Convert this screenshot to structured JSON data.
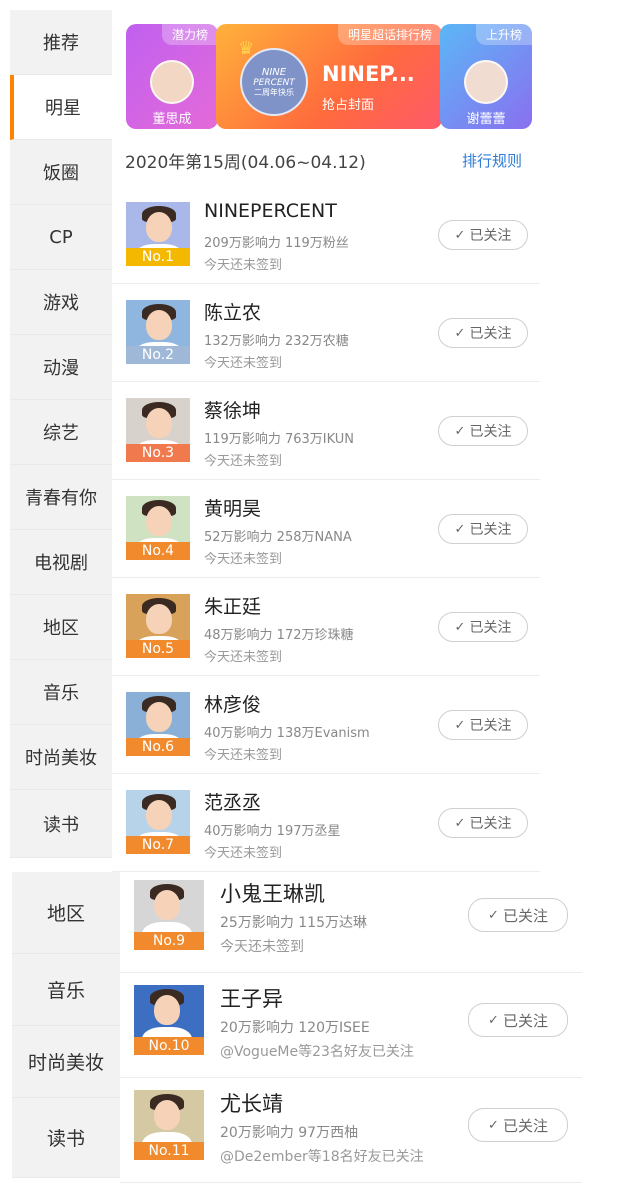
{
  "sidebar_top": {
    "items": [
      "推荐",
      "明星",
      "饭圈",
      "CP",
      "游戏",
      "动漫",
      "综艺",
      "青春有你",
      "电视剧",
      "地区",
      "音乐",
      "时尚美妆",
      "读书"
    ],
    "active_index": 1
  },
  "sidebar_bottom": {
    "items": [
      "地区",
      "音乐",
      "时尚美妆",
      "读书"
    ]
  },
  "banner": {
    "left": {
      "tag": "潜力榜",
      "name": "董思成"
    },
    "center": {
      "tag": "明星超话排行榜",
      "title": "NINEP...",
      "subtitle": "抢占封面",
      "logo_line1": "NINE",
      "logo_line2": "PERCENT",
      "logo_line3": "二周年快乐"
    },
    "right": {
      "tag": "上升榜",
      "name": "谢蕾蕾"
    }
  },
  "week": {
    "label": "2020年第15周(04.06~04.12)",
    "rules": "排行规则"
  },
  "follow_label": "已关注",
  "rows": [
    {
      "name": "NINEPERCENT",
      "stats": "209万影响力 119万粉丝",
      "sub": "今天还未签到",
      "rank": "No.1",
      "rank_color": "#f5b800",
      "bg": "#a9b8e8"
    },
    {
      "name": "陈立农",
      "stats": "132万影响力 232万农糖",
      "sub": "今天还未签到",
      "rank": "No.2",
      "rank_color": "#9fb8d8",
      "bg": "#8fb6de"
    },
    {
      "name": "蔡徐坤",
      "stats": "119万影响力 763万IKUN",
      "sub": "今天还未签到",
      "rank": "No.3",
      "rank_color": "#f07a4e",
      "bg": "#d8d2cc"
    },
    {
      "name": "黄明昊",
      "stats": "52万影响力 258万NANA",
      "sub": "今天还未签到",
      "rank": "No.4",
      "rank_color": "#f08a2c",
      "bg": "#cfe3c2"
    },
    {
      "name": "朱正廷",
      "stats": "48万影响力 172万珍珠糖",
      "sub": "今天还未签到",
      "rank": "No.5",
      "rank_color": "#f08a2c",
      "bg": "#d9a25a"
    },
    {
      "name": "林彦俊",
      "stats": "40万影响力 138万Evanism",
      "sub": "今天还未签到",
      "rank": "No.6",
      "rank_color": "#f08a2c",
      "bg": "#8ab0d8"
    },
    {
      "name": "范丞丞",
      "stats": "40万影响力 197万丞星",
      "sub": "今天还未签到",
      "rank": "No.7",
      "rank_color": "#f08a2c",
      "bg": "#b7d3ea"
    }
  ],
  "rows2": [
    {
      "name": "小鬼王琳凯",
      "stats": "25万影响力 115万达琳",
      "sub": "今天还未签到",
      "rank": "No.9",
      "rank_color": "#f08a2c",
      "bg": "#d6d6d6"
    },
    {
      "name": "王子异",
      "stats": "20万影响力 120万ISEE",
      "sub": "@VogueMe等23名好友已关注",
      "rank": "No.10",
      "rank_color": "#f08a2c",
      "bg": "#3c6fc2"
    },
    {
      "name": "尤长靖",
      "stats": "20万影响力 97万西柚",
      "sub": "@De2ember等18名好友已关注",
      "rank": "No.11",
      "rank_color": "#f08a2c",
      "bg": "#d4c9a2"
    }
  ]
}
